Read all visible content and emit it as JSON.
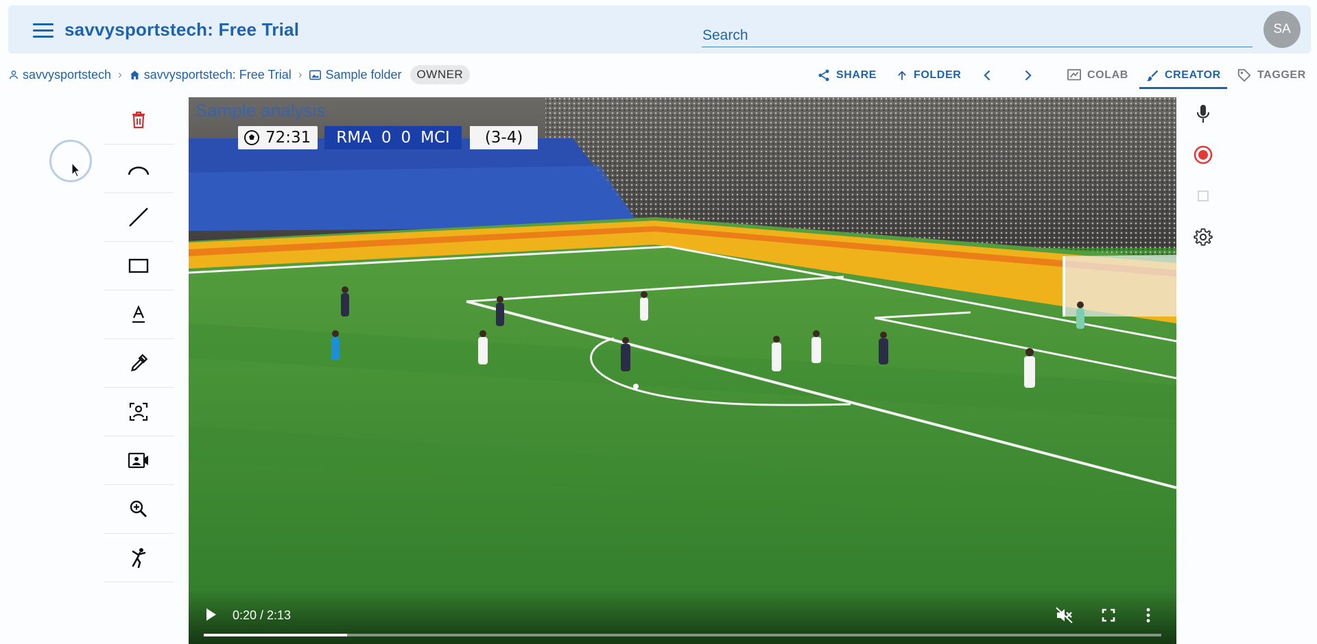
{
  "app": {
    "title": "savvysportstech: Free Trial",
    "search_placeholder": "Search",
    "avatar_initials": "SA"
  },
  "breadcrumb": {
    "items": [
      {
        "label": "savvysportstech",
        "icon": "person-icon"
      },
      {
        "label": "savvysportstech: Free Trial",
        "icon": "home-icon"
      },
      {
        "label": "Sample folder",
        "icon": "image-folder-icon"
      }
    ],
    "role_badge": "OWNER"
  },
  "toolbar": {
    "share_label": "SHARE",
    "folder_label": "FOLDER",
    "colab_label": "COLAB",
    "creator_label": "CREATOR",
    "tagger_label": "TAGGER",
    "active_tab": "CREATOR"
  },
  "tools": [
    {
      "name": "delete-tool",
      "icon": "trash-icon"
    },
    {
      "name": "arc-tool",
      "icon": "arc-icon"
    },
    {
      "name": "line-tool",
      "icon": "line-icon"
    },
    {
      "name": "rectangle-tool",
      "icon": "rectangle-icon"
    },
    {
      "name": "text-tool",
      "icon": "text-icon"
    },
    {
      "name": "color-picker-tool",
      "icon": "eyedropper-icon"
    },
    {
      "name": "player-highlight-tool",
      "icon": "person-focus-icon"
    },
    {
      "name": "video-clip-tool",
      "icon": "video-card-icon"
    },
    {
      "name": "zoom-tool",
      "icon": "zoom-in-icon"
    },
    {
      "name": "skeleton-tool",
      "icon": "kick-figure-icon"
    }
  ],
  "video": {
    "overlay_title": "Sample analysis",
    "scorebug": {
      "clock": "72:31",
      "home": "RMA",
      "home_score": "0",
      "away_score": "0",
      "away": "MCI",
      "aggregate": "(3-4)"
    },
    "time_display": "0:20 / 2:13",
    "progress": 0.15,
    "muted": true
  },
  "right_rail": [
    {
      "name": "microphone-button",
      "icon": "microphone-icon"
    },
    {
      "name": "record-button",
      "icon": "record-icon"
    },
    {
      "name": "stop-button",
      "icon": "stop-icon"
    },
    {
      "name": "settings-button",
      "icon": "gear-icon"
    }
  ],
  "colors": {
    "brand": "#1f63ad",
    "app_bar": "#e6f0fa",
    "delete": "#d32f2f",
    "record": "#e53935",
    "pitch": "#3f8a33"
  }
}
